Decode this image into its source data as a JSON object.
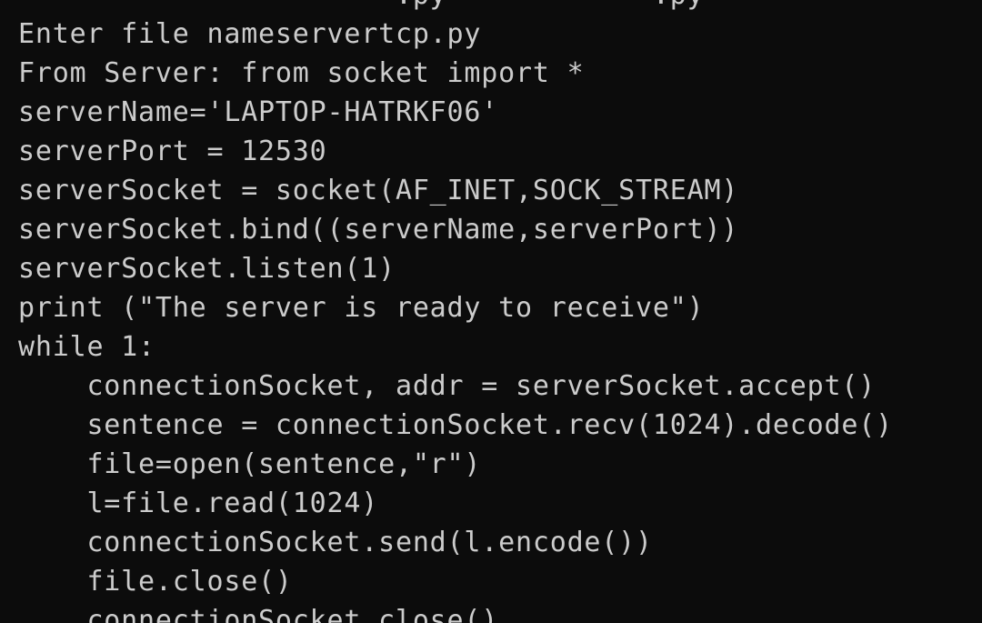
{
  "terminal": {
    "lines": [
      "                      .py            .py",
      "Enter file nameservertcp.py",
      "From Server: from socket import *",
      "serverName='LAPTOP-HATRKF06'",
      "serverPort = 12530",
      "serverSocket = socket(AF_INET,SOCK_STREAM)",
      "serverSocket.bind((serverName,serverPort))",
      "serverSocket.listen(1)",
      "print (\"The server is ready to receive\")",
      "while 1:",
      "    connectionSocket, addr = serverSocket.accept()",
      "    sentence = connectionSocket.recv(1024).decode()",
      "    file=open(sentence,\"r\")",
      "    l=file.read(1024)",
      "    connectionSocket.send(l.encode())",
      "    file.close()",
      "    connectionSocket.close()"
    ]
  },
  "colors": {
    "background": "#0c0c0c",
    "text": "#cccccc"
  }
}
